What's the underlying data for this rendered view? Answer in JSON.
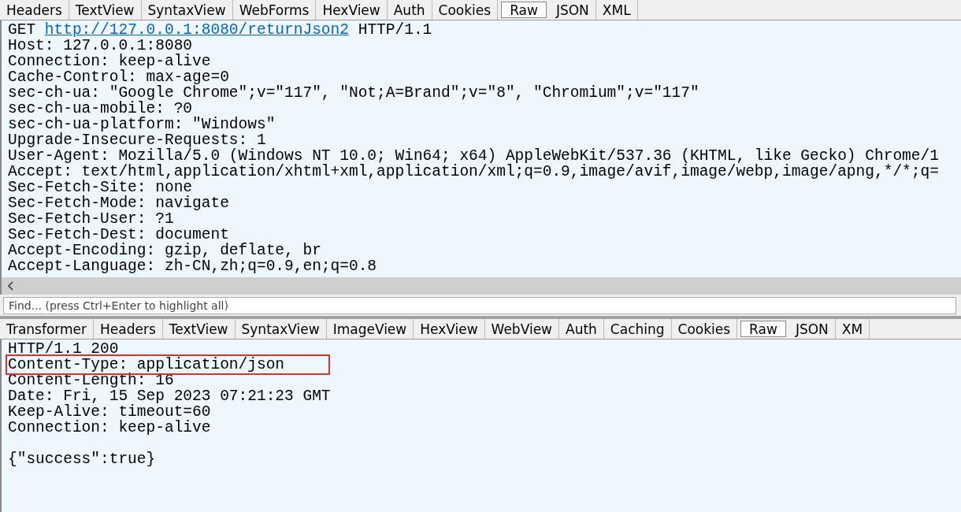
{
  "request_tabs": [
    {
      "label": "Headers",
      "selected": false
    },
    {
      "label": "TextView",
      "selected": false
    },
    {
      "label": "SyntaxView",
      "selected": false
    },
    {
      "label": "WebForms",
      "selected": false
    },
    {
      "label": "HexView",
      "selected": false
    },
    {
      "label": "Auth",
      "selected": false
    },
    {
      "label": "Cookies",
      "selected": false
    },
    {
      "label": "Raw",
      "selected": true
    },
    {
      "label": "JSON",
      "selected": false
    },
    {
      "label": "XML",
      "selected": false
    }
  ],
  "request": {
    "method": "GET",
    "url": "http://127.0.0.1:8080/returnJson2",
    "version": "HTTP/1.1",
    "headers": [
      "Host: 127.0.0.1:8080",
      "Connection: keep-alive",
      "Cache-Control: max-age=0",
      "sec-ch-ua: \"Google Chrome\";v=\"117\", \"Not;A=Brand\";v=\"8\", \"Chromium\";v=\"117\"",
      "sec-ch-ua-mobile: ?0",
      "sec-ch-ua-platform: \"Windows\"",
      "Upgrade-Insecure-Requests: 1",
      "User-Agent: Mozilla/5.0 (Windows NT 10.0; Win64; x64) AppleWebKit/537.36 (KHTML, like Gecko) Chrome/1",
      "Accept: text/html,application/xhtml+xml,application/xml;q=0.9,image/avif,image/webp,image/apng,*/*;q=",
      "Sec-Fetch-Site: none",
      "Sec-Fetch-Mode: navigate",
      "Sec-Fetch-User: ?1",
      "Sec-Fetch-Dest: document",
      "Accept-Encoding: gzip, deflate, br",
      "Accept-Language: zh-CN,zh;q=0.9,en;q=0.8"
    ]
  },
  "find": {
    "placeholder": "Find... (press Ctrl+Enter to highlight all)"
  },
  "response_tabs": [
    {
      "label": "Transformer",
      "selected": false
    },
    {
      "label": "Headers",
      "selected": false
    },
    {
      "label": "TextView",
      "selected": false
    },
    {
      "label": "SyntaxView",
      "selected": false
    },
    {
      "label": "ImageView",
      "selected": false
    },
    {
      "label": "HexView",
      "selected": false
    },
    {
      "label": "WebView",
      "selected": false
    },
    {
      "label": "Auth",
      "selected": false
    },
    {
      "label": "Caching",
      "selected": false
    },
    {
      "label": "Cookies",
      "selected": false
    },
    {
      "label": "Raw",
      "selected": true
    },
    {
      "label": "JSON",
      "selected": false
    },
    {
      "label": "XM",
      "selected": false
    }
  ],
  "response": {
    "lines": [
      {
        "text": "HTTP/1.1 200",
        "highlighted": false
      },
      {
        "text": "Content-Type: application/json",
        "highlighted": true
      },
      {
        "text": "Content-Length: 16",
        "highlighted": false
      },
      {
        "text": "Date: Fri, 15 Sep 2023 07:21:23 GMT",
        "highlighted": false
      },
      {
        "text": "Keep-Alive: timeout=60",
        "highlighted": false
      },
      {
        "text": "Connection: keep-alive",
        "highlighted": false
      }
    ],
    "body": "{\"success\":true}"
  }
}
